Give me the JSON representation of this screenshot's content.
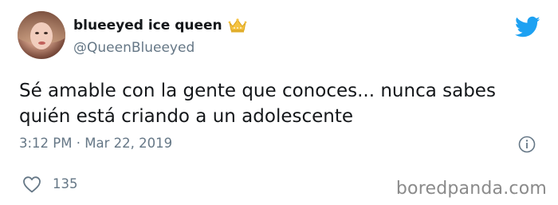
{
  "author": {
    "display_name": "blueeyed ice queen",
    "handle": "@QueenBlueeyed",
    "name_emoji": "crown-icon"
  },
  "tweet": {
    "lines": [
      "Sé amable con la gente que conoces... nunca sabes",
      "quién está criando a un adolescente"
    ],
    "timestamp": "3:12 PM · Mar 22, 2019",
    "likes": "135"
  },
  "watermark": "boredpanda.com",
  "colors": {
    "twitter_blue": "#1da1f2",
    "secondary_text": "#657786",
    "primary_text": "#14171a"
  }
}
